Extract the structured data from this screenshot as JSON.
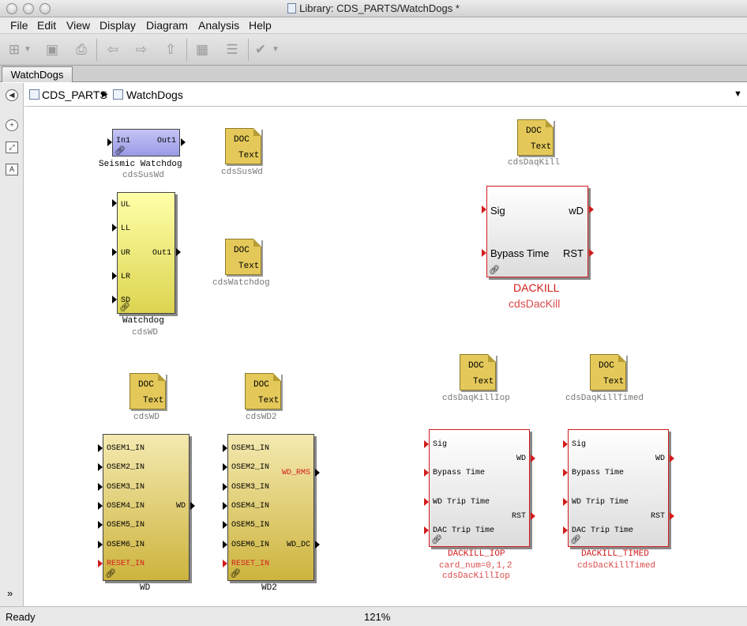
{
  "window": {
    "title": "Library: CDS_PARTS/WatchDogs *"
  },
  "menu": [
    "File",
    "Edit",
    "View",
    "Display",
    "Diagram",
    "Analysis",
    "Help"
  ],
  "tab": {
    "label": "WatchDogs"
  },
  "breadcrumb": {
    "root": "CDS_PARTS",
    "current": "WatchDogs"
  },
  "status": {
    "left": "Ready",
    "zoom": "121%"
  },
  "icons": [
    "new-model-icon",
    "save-icon",
    "print-icon",
    "back-icon",
    "forward-icon",
    "up-icon",
    "library-browser-icon",
    "model-explorer-icon",
    "check-icon",
    "dropdown-icon",
    "hide-browser-icon",
    "zoom-icon",
    "fit-icon",
    "annotation-icon",
    "expand-icon",
    "link-icon"
  ],
  "doc": {
    "line1": "DOC",
    "line2": "Text"
  },
  "blocks": {
    "seismic": {
      "in": "In1",
      "out": "Out1",
      "name": "Seismic Watchdog",
      "lib": "cdsSusWd"
    },
    "doc_suswd": {
      "lib": "cdsSusWd"
    },
    "watchdog": {
      "ports": [
        "UL",
        "LL",
        "UR",
        "LR",
        "SD"
      ],
      "out": "Out1",
      "name": "Watchdog",
      "lib": "cdsWD"
    },
    "doc_watchdog": {
      "lib": "cdsWatchdog"
    },
    "doc_daqkill": {
      "lib": "cdsDaqKill"
    },
    "dackill": {
      "in1": "Sig",
      "in2": "Bypass Time",
      "out1": "wD",
      "out2": "RST",
      "name": "DACKILL",
      "lib": "cdsDacKill"
    },
    "doc_wd": {
      "lib": "cdsWD"
    },
    "doc_wd2": {
      "lib": "cdsWD2"
    },
    "doc_daqkilliop": {
      "lib": "cdsDaqKillIop"
    },
    "doc_daqkilltimed": {
      "lib": "cdsDaqKillTimed"
    },
    "wd": {
      "ports": [
        "OSEM1_IN",
        "OSEM2_IN",
        "OSEM3_IN",
        "OSEM4_IN",
        "OSEM5_IN",
        "OSEM6_IN"
      ],
      "reset": "RESET_IN",
      "out": "WD",
      "name": "WD"
    },
    "wd2": {
      "ports": [
        "OSEM1_IN",
        "OSEM2_IN",
        "OSEM3_IN",
        "OSEM4_IN",
        "OSEM5_IN",
        "OSEM6_IN"
      ],
      "reset": "RESET_IN",
      "out1": "WD_RMS",
      "out2": "WD_DC",
      "name": "WD2"
    },
    "dackill_iop": {
      "ins": [
        "Sig",
        "Bypass Time",
        "WD Trip Time",
        "DAC Trip Time"
      ],
      "out1": "WD",
      "out2": "RST",
      "name": "DACKILL_IOP",
      "param": "card_num=0,1,2",
      "lib": "cdsDacKillIop"
    },
    "dackill_timed": {
      "ins": [
        "Sig",
        "Bypass Time",
        "WD Trip Time",
        "DAC Trip Time"
      ],
      "out1": "WD",
      "out2": "RST",
      "name": "DACKILL_TIMED",
      "lib": "cdsDacKillTimed"
    }
  }
}
